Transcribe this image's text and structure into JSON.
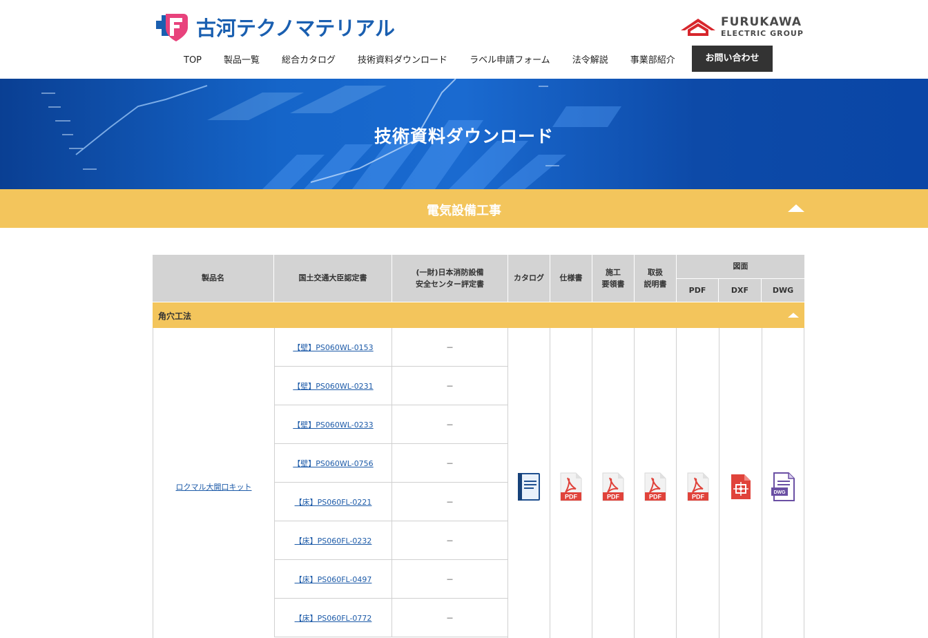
{
  "brand": {
    "company_name": "古河テクノマテリアル",
    "group_name_line1": "FURUKAWA",
    "group_name_line2": "ELECTRIC GROUP",
    "brand_blue": "#1a5fb0",
    "brand_pink": "#e8427c",
    "group_red": "#d7262c"
  },
  "nav": {
    "items": [
      {
        "label": "TOP"
      },
      {
        "label": "製品一覧"
      },
      {
        "label": "総合カタログ"
      },
      {
        "label": "技術資料ダウンロード"
      },
      {
        "label": "ラベル申請フォーム"
      },
      {
        "label": "法令解説"
      },
      {
        "label": "事業部紹介"
      }
    ],
    "contact_label": "お問い合わせ"
  },
  "hero": {
    "title": "技術資料ダウンロード"
  },
  "category": {
    "title": "電気設備工事",
    "accent": "#f3c55c"
  },
  "table": {
    "headers": {
      "product_name": "製品名",
      "mlit_cert": "国土交通大臣認定書",
      "fire_cert": "(一財)日本消防設備\n安全センター評定書",
      "catalog": "カタログ",
      "spec": "仕様書",
      "construction": "施工\n要領書",
      "manual": "取扱\n説明書",
      "drawing": "図面",
      "pdf": "PDF",
      "dxf": "DXF",
      "dwg": "DWG"
    },
    "section_label": "角穴工法",
    "product": {
      "name": "ロクマル大開口キット",
      "rows": [
        {
          "cert": "【壁】PS060WL-0153",
          "fire": "－"
        },
        {
          "cert": "【壁】PS060WL-0231",
          "fire": "－"
        },
        {
          "cert": "【壁】PS060WL-0233",
          "fire": "－"
        },
        {
          "cert": "【壁】PS060WL-0756",
          "fire": "－"
        },
        {
          "cert": "【床】PS060FL-0221",
          "fire": "－"
        },
        {
          "cert": "【床】PS060FL-0232",
          "fire": "－"
        },
        {
          "cert": "【床】PS060FL-0497",
          "fire": "－"
        },
        {
          "cert": "【床】PS060FL-0772",
          "fire": "－"
        }
      ],
      "icons": {
        "catalog": "catalog-book-icon",
        "spec": "pdf-file-icon",
        "construction": "pdf-file-icon",
        "manual": "pdf-file-icon",
        "drawing_pdf": "pdf-file-icon",
        "drawing_dxf": "dxf-file-icon",
        "drawing_dwg": "dwg-file-icon",
        "pdf_badge": "PDF",
        "dwg_badge": "DWG"
      }
    }
  }
}
